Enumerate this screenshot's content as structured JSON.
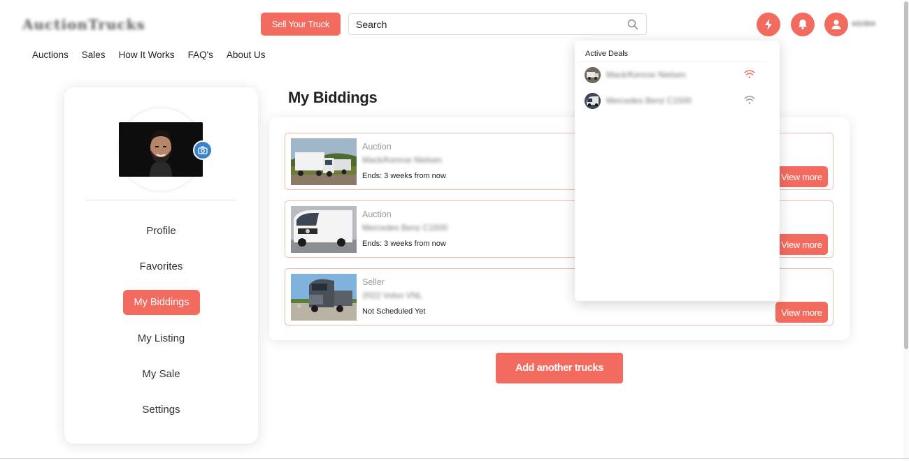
{
  "header": {
    "logo_text": "AuctionTrucks",
    "sell_label": "Sell Your Truck",
    "search_placeholder": "Search",
    "username": "wizdee",
    "colors": {
      "accent": "#f36b5f",
      "badge": "#3b82c8"
    }
  },
  "nav": {
    "items": [
      {
        "label": "Auctions"
      },
      {
        "label": "Sales"
      },
      {
        "label": "How It Works"
      },
      {
        "label": "FAQ's"
      },
      {
        "label": "About Us"
      }
    ]
  },
  "sidebar": {
    "avatar_icon": "camera-icon",
    "items": [
      {
        "label": "Profile"
      },
      {
        "label": "Favorites"
      },
      {
        "label": "My Biddings",
        "active": true
      },
      {
        "label": "My Listing"
      },
      {
        "label": "My Sale"
      },
      {
        "label": "Settings"
      }
    ]
  },
  "main": {
    "title": "My Biddings",
    "biddings": [
      {
        "type": "Auction",
        "name": "Mack/Kenroe Nielsen",
        "status": "Ends: 3 weeks from now",
        "action": "View more"
      },
      {
        "type": "Auction",
        "name": "Mercedes Benz C1500",
        "status": "Ends: 3 weeks from now",
        "action": "View more"
      },
      {
        "type": "Seller",
        "name": "2022 Volvo VNL",
        "status": "Not Scheduled Yet",
        "action": "View more"
      }
    ],
    "add_label": "Add another trucks"
  },
  "active_deals": {
    "title": "Active Deals",
    "items": [
      {
        "name": "Mack/Kenroe Nielsen",
        "signal": "active",
        "signal_color": "#f36b5f"
      },
      {
        "name": "Mercedes Benz C1500",
        "signal": "inactive",
        "signal_color": "#9a9a9a"
      }
    ]
  }
}
